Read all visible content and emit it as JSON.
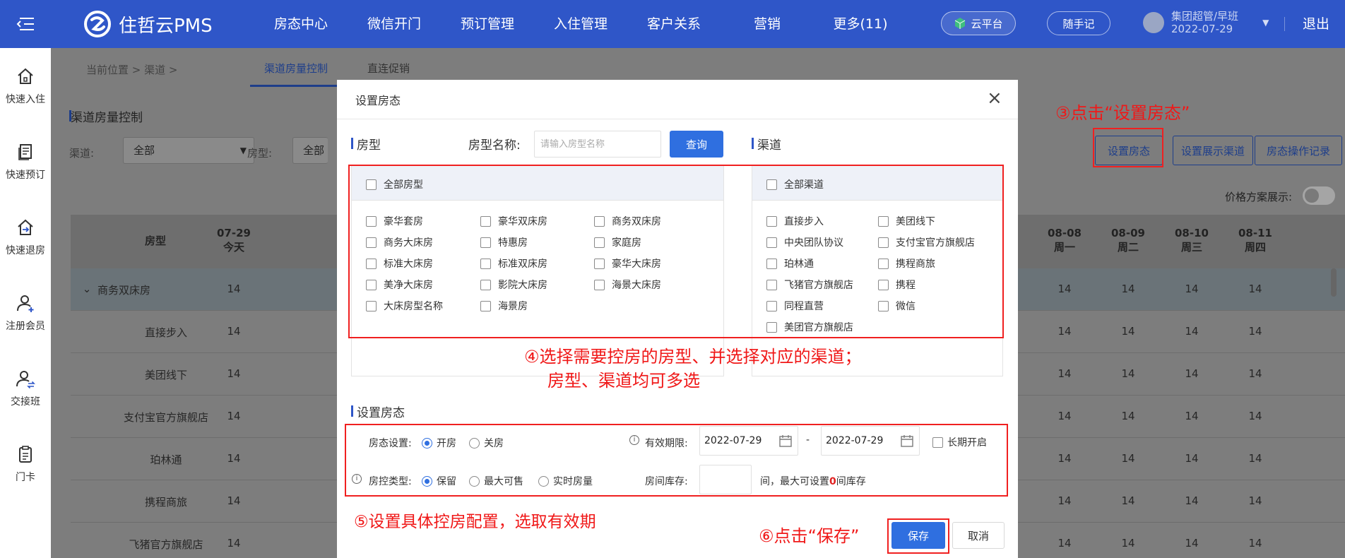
{
  "app": {
    "name": "住哲云PMS"
  },
  "nav": [
    "房态中心",
    "微信开门",
    "预订管理",
    "入住管理",
    "客户关系",
    "营销",
    "更多(11)"
  ],
  "header": {
    "cloud_label": "云平台",
    "memo_label": "随手记",
    "user_name": "集团超管/早班",
    "user_date": "2022-07-29",
    "logout_label": "退出"
  },
  "sidebar": [
    "快速入住",
    "快速预订",
    "快速退房",
    "注册会员",
    "交接班",
    "门卡"
  ],
  "page": {
    "breadcrumb": "当前位置 > 渠道 >",
    "tabs": [
      "渠道房量控制",
      "直连促销"
    ],
    "section_title": "渠道房量控制",
    "filter_channel_label": "渠道:",
    "filter_channel_value": "全部",
    "filter_roomtype_label": "房型:",
    "filter_roomtype_value": "全部",
    "actions": [
      "设置房态",
      "设置展示渠道",
      "房态操作记录"
    ],
    "price_toggle_label": "价格方案展示:"
  },
  "table": {
    "col_roomtype": "房型",
    "first_date": {
      "date": "07-29",
      "day": "今天"
    },
    "right_dates": [
      {
        "date": "08-08",
        "day": "周一"
      },
      {
        "date": "08-09",
        "day": "周二"
      },
      {
        "date": "08-10",
        "day": "周三"
      },
      {
        "date": "08-11",
        "day": "周四"
      }
    ],
    "rows": [
      "商务双床房",
      "直接步入",
      "美团线下",
      "支付宝官方旗舰店",
      "珀林通",
      "携程商旅",
      "飞猪官方旗舰店"
    ],
    "value": "14",
    "group_caret": "⌄"
  },
  "modal": {
    "title": "设置房态",
    "close": "×",
    "roomtype_label": "房型",
    "roomtype_search_label": "房型名称:",
    "roomtype_search_placeholder": "请输入房型名称",
    "query_label": "查询",
    "all_roomtypes": "全部房型",
    "roomtypes": [
      [
        "豪华套房",
        "豪华双床房",
        "商务双床房"
      ],
      [
        "商务大床房",
        "特惠房",
        "家庭房"
      ],
      [
        "标准大床房",
        "标准双床房",
        "豪华大床房"
      ],
      [
        "美净大床房",
        "影院大床房",
        "海景大床房"
      ],
      [
        "大床房型名称",
        "海景房"
      ]
    ],
    "channel_label": "渠道",
    "all_channels": "全部渠道",
    "channels": [
      [
        "直接步入",
        "美团线下"
      ],
      [
        "中央团队协议",
        "支付宝官方旗舰店"
      ],
      [
        "珀林通",
        "携程商旅"
      ],
      [
        "飞猪官方旗舰店",
        "携程"
      ],
      [
        "同程直营",
        "微信"
      ],
      [
        "美团官方旗舰店"
      ]
    ],
    "settings_label": "设置房态",
    "status_label": "房态设置:",
    "status_options": [
      "开房",
      "关房"
    ],
    "validity_label": "有效期限:",
    "date_from": "2022-07-29",
    "date_to": "2022-07-29",
    "date_sep": "-",
    "long_term_label": "长期开启",
    "control_label": "房控类型:",
    "control_options": [
      "保留",
      "最大可售",
      "实时房量"
    ],
    "inventory_label": "房间库存:",
    "inventory_suffix_1": "间，最大可设置",
    "inventory_max": "0",
    "inventory_suffix_2": "间库存",
    "save_label": "保存",
    "cancel_label": "取消"
  },
  "annotations": {
    "step3": "③点击“设置房态”",
    "step4_line1": "④选择需要控房的房型、并选择对应的渠道；",
    "step4_line2": "房型、渠道均可多选",
    "step5": "⑤设置具体控房配置，选取有效期",
    "step6": "⑥点击“保存”"
  },
  "colors": {
    "brand_blue": "#2f56c8",
    "primary_button": "#2f6fe0",
    "annotation_red": "#f02020",
    "inventory_max": "#e02020"
  }
}
